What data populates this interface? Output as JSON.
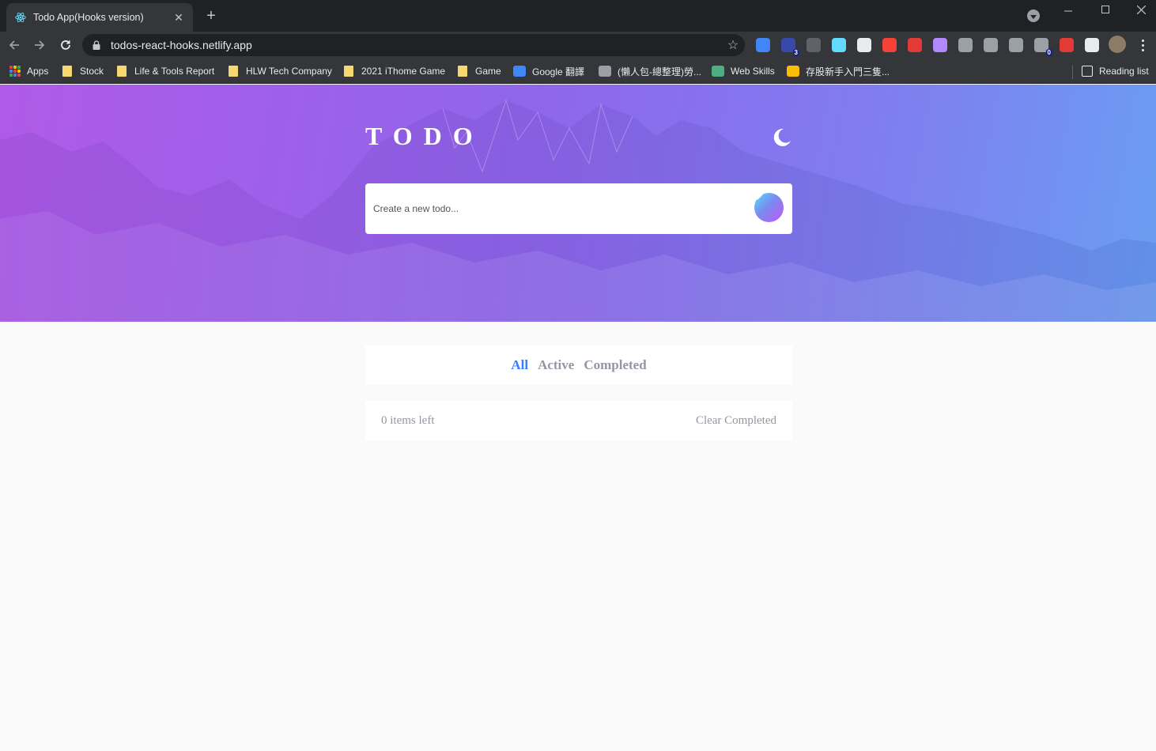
{
  "browser": {
    "tab_title": "Todo App(Hooks version)",
    "url": "todos-react-hooks.netlify.app",
    "extensions": [
      {
        "icon": "google-translate-icon",
        "color": "#4285f4",
        "badge": ""
      },
      {
        "icon": "cube-icon",
        "color": "#3949ab",
        "badge": "3"
      },
      {
        "icon": "vue-icon",
        "color": "#5f6368",
        "badge": ""
      },
      {
        "icon": "react-icon",
        "color": "#61dafb",
        "badge": ""
      },
      {
        "icon": "translate-icon",
        "color": "#e8eaed",
        "badge": ""
      },
      {
        "icon": "adblock-icon",
        "color": "#f44336",
        "badge": ""
      },
      {
        "icon": "s-icon",
        "color": "#e53935",
        "badge": ""
      },
      {
        "icon": "brush-icon",
        "color": "#b388ff",
        "badge": ""
      },
      {
        "icon": "camera-icon",
        "color": "#9aa0a6",
        "badge": ""
      },
      {
        "icon": "check-icon",
        "color": "#9aa0a6",
        "badge": ""
      },
      {
        "icon": "window-icon",
        "color": "#9aa0a6",
        "badge": ""
      },
      {
        "icon": "counter-icon",
        "color": "#9aa0a6",
        "badge": "0"
      },
      {
        "icon": "grid-icon",
        "color": "#e53935",
        "badge": ""
      },
      {
        "icon": "puzzle-icon",
        "color": "#e8eaed",
        "badge": ""
      }
    ],
    "bookmarks": [
      {
        "label": "Apps",
        "icon": "apps-grid-icon"
      },
      {
        "label": "Stock",
        "icon": "folder-icon"
      },
      {
        "label": "Life & Tools Report",
        "icon": "folder-icon"
      },
      {
        "label": "HLW Tech Company",
        "icon": "folder-icon"
      },
      {
        "label": "2021 iThome Game",
        "icon": "folder-icon"
      },
      {
        "label": "Game",
        "icon": "folder-icon"
      },
      {
        "label": "Google 翻譯",
        "icon": "google-translate-icon"
      },
      {
        "label": "(懶人包-總整理)勞...",
        "icon": "bird-icon"
      },
      {
        "label": "Web Skills",
        "icon": "cloud-icon"
      },
      {
        "label": "存股新手入門三隻...",
        "icon": "drive-icon"
      }
    ],
    "reading_list": "Reading list"
  },
  "app": {
    "title": "TODO",
    "input_placeholder": "Create a new todo...",
    "filters": [
      {
        "label": "All",
        "active": true
      },
      {
        "label": "Active",
        "active": false
      },
      {
        "label": "Completed",
        "active": false
      }
    ],
    "items_left": "0 items left",
    "clear_completed": "Clear Completed"
  },
  "colors": {
    "accent": "#3a7cfd",
    "muted": "#9495a5",
    "page_bg": "#fafafa"
  }
}
